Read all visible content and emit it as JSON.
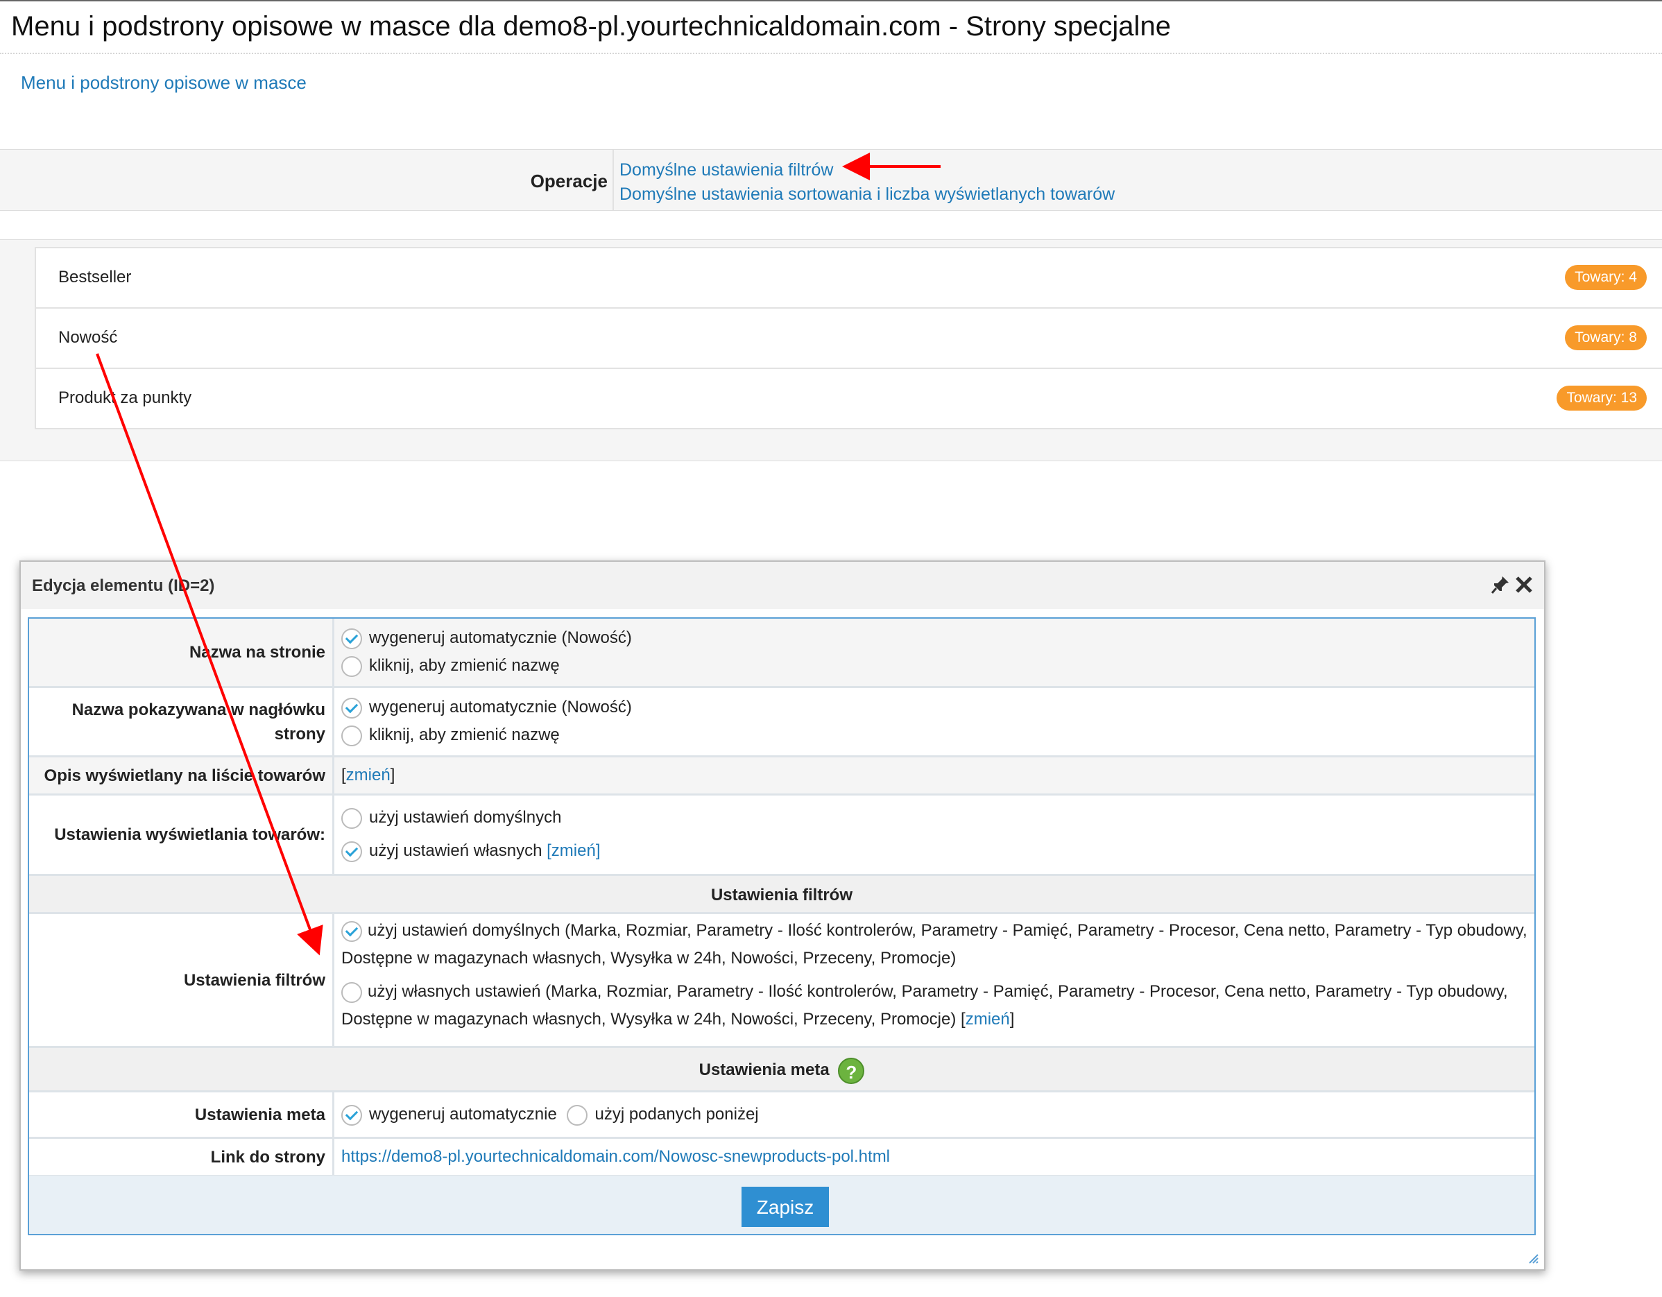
{
  "header": {
    "title": "Menu i podstrony opisowe w masce dla demo8-pl.yourtechnicaldomain.com - Strony specjalne"
  },
  "breadcrumb": {
    "link": "Menu i podstrony opisowe w masce"
  },
  "operations": {
    "label": "Operacje",
    "links": [
      "Domyślne ustawienia filtrów",
      "Domyślne ustawienia sortowania i liczba wyświetlanych towarów"
    ]
  },
  "list": {
    "items": [
      {
        "name": "Bestseller",
        "badge": "Towary: 4"
      },
      {
        "name": "Nowość",
        "badge": "Towary: 8"
      },
      {
        "name": "Produkt za punkty",
        "badge": "Towary: 13"
      }
    ]
  },
  "dialog": {
    "title": "Edycja elementu (ID=2)",
    "icons": {
      "pin": "pin-icon",
      "close": "close-icon",
      "help": "help-icon",
      "resize": "resize-handle-icon"
    },
    "name_on_page": {
      "label": "Nazwa na stronie",
      "auto": "wygeneruj automatycznie (Nowość)",
      "manual": "kliknij, aby zmienić nazwę",
      "selected": "auto"
    },
    "header_name": {
      "label": "Nazwa pokazywana w nagłówku strony",
      "auto": "wygeneruj automatycznie (Nowość)",
      "manual": "kliknij, aby zmienić nazwę",
      "selected": "auto"
    },
    "description": {
      "label": "Opis wyświetlany na liście towarów",
      "open": "[",
      "link": "zmień",
      "close": "]"
    },
    "display_settings": {
      "label": "Ustawienia wyświetlania towarów:",
      "default": "użyj ustawień domyślnych",
      "custom": "użyj ustawień własnych",
      "custom_link": "[zmień]",
      "selected": "custom"
    },
    "filters_section": {
      "title": "Ustawienia filtrów"
    },
    "filters": {
      "label": "Ustawienia filtrów",
      "default": "użyj ustawień domyślnych (Marka, Rozmiar, Parametry - Ilość kontrolerów, Parametry - Pamięć, Parametry - Procesor, Cena netto, Parametry - Typ obudowy, Dostępne w magazynach własnych, Wysyłka w 24h, Nowości, Przeceny, Promocje)",
      "custom": "użyj własnych ustawień (Marka, Rozmiar, Parametry - Ilość kontrolerów, Parametry - Pamięć, Parametry - Procesor, Cena netto, Parametry - Typ obudowy, Dostępne w magazynach własnych, Wysyłka w 24h, Nowości, Przeceny, Promocje)",
      "custom_open": "[",
      "custom_link": "zmień",
      "custom_close": "]",
      "selected": "default"
    },
    "meta_section": {
      "title": "Ustawienia meta",
      "help_glyph": "?"
    },
    "meta": {
      "label": "Ustawienia meta",
      "auto": "wygeneruj automatycznie",
      "manual": "użyj podanych poniżej",
      "selected": "auto"
    },
    "link": {
      "label": "Link do strony",
      "url": "https://demo8-pl.yourtechnicaldomain.com/Nowosc-snewproducts-pol.html"
    },
    "save": "Zapisz"
  },
  "colors": {
    "link": "#1f7ab8",
    "badge": "#f89a2a",
    "annotation_arrow": "#ff0000",
    "save_button": "#2f8fd2",
    "form_border": "#5aa0d6"
  }
}
